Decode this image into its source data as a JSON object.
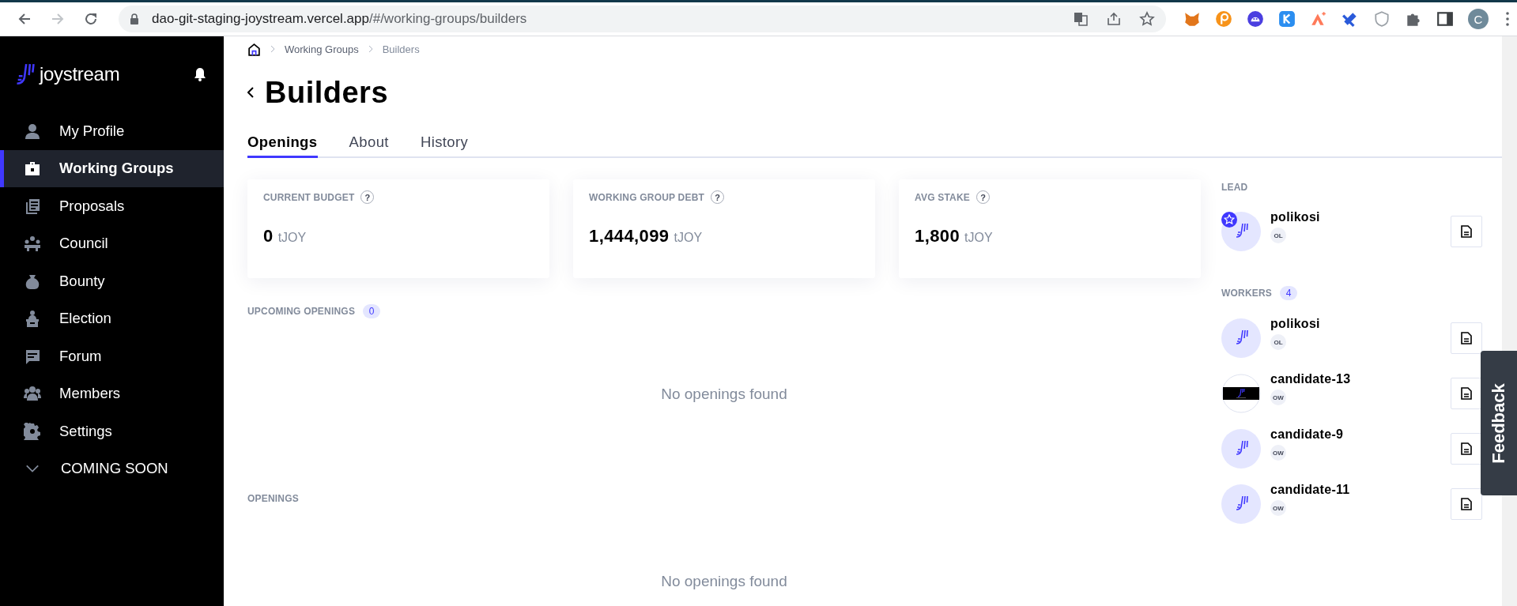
{
  "browser": {
    "url_host": "dao-git-staging-joystream.vercel.app",
    "url_path": "/#/working-groups/builders",
    "profile_initial": "C"
  },
  "sidebar": {
    "logo": "joystream",
    "items": [
      {
        "label": "My Profile",
        "selected": false
      },
      {
        "label": "Working Groups",
        "selected": true
      },
      {
        "label": "Proposals",
        "selected": false
      },
      {
        "label": "Council",
        "selected": false
      },
      {
        "label": "Bounty",
        "selected": false
      },
      {
        "label": "Election",
        "selected": false
      },
      {
        "label": "Forum",
        "selected": false
      },
      {
        "label": "Members",
        "selected": false
      },
      {
        "label": "Settings",
        "selected": false
      }
    ],
    "section": {
      "label": "COMING SOON",
      "expanded": false
    }
  },
  "breadcrumbs": [
    "Working Groups",
    "Builders"
  ],
  "title": "Builders",
  "tabs": [
    {
      "label": "Openings",
      "selected": true
    },
    {
      "label": "About",
      "selected": false
    },
    {
      "label": "History",
      "selected": false
    }
  ],
  "stats": [
    {
      "label": "CURRENT BUDGET",
      "help": "?",
      "value": "0",
      "unit": "tJOY"
    },
    {
      "label": "WORKING GROUP DEBT",
      "help": "?",
      "value": "1,444,099",
      "unit": "tJOY"
    },
    {
      "label": "AVG STAKE",
      "help": "?",
      "value": "1,800",
      "unit": "tJOY"
    }
  ],
  "sections": [
    {
      "label": "UPCOMING OPENINGS",
      "count": "0",
      "empty": "No openings found"
    },
    {
      "label": "OPENINGS",
      "empty": "No openings found"
    }
  ],
  "lead": {
    "label": "LEAD",
    "member": {
      "name": "polikosi",
      "badge": "OL",
      "is_lead": true,
      "has_photo": false
    }
  },
  "workers": {
    "label": "WORKERS",
    "count": "4",
    "members": [
      {
        "name": "polikosi",
        "badge": "OL",
        "is_lead": false,
        "has_photo": false
      },
      {
        "name": "candidate-13",
        "badge": "OW",
        "is_lead": false,
        "has_photo": true
      },
      {
        "name": "candidate-9",
        "badge": "OW",
        "is_lead": false,
        "has_photo": false
      },
      {
        "name": "candidate-11",
        "badge": "OW",
        "is_lead": false,
        "has_photo": false
      }
    ]
  },
  "feedback": "Feedback"
}
